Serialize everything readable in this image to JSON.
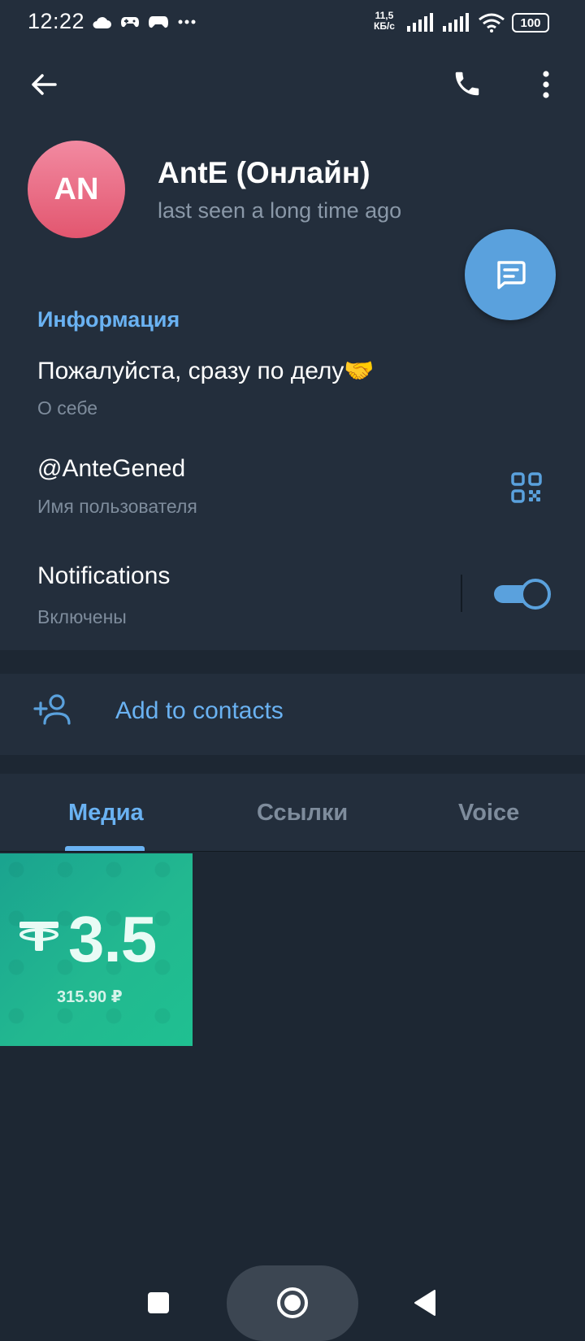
{
  "status_bar": {
    "time": "12:22",
    "net_speed_value": "11,5",
    "net_speed_unit": "КБ/с",
    "battery": "100",
    "icons": [
      "cloud-icon",
      "gamepad-icon",
      "gamepad-icon",
      "more-dots-icon",
      "signal-icon",
      "signal-icon",
      "wifi-icon",
      "battery-icon"
    ]
  },
  "toolbar": {
    "back_icon": "arrow-left-icon",
    "call_icon": "phone-icon",
    "menu_icon": "more-vertical-icon"
  },
  "profile": {
    "avatar_initials": "AN",
    "name": "AntE (Онлайн)",
    "status": "last seen a long time ago",
    "avatar_colors": [
      "#f28aa1",
      "#e2566f"
    ]
  },
  "fab": {
    "icon": "message-icon",
    "color": "#5aa1dd"
  },
  "info": {
    "section_title": "Информация",
    "bio_value": "Пожалуйста, сразу по делу🤝",
    "bio_label": "О себе",
    "username_value": "@AnteGened",
    "username_label": "Имя пользователя",
    "qr_icon": "qr-code-icon",
    "notifications_value": "Notifications",
    "notifications_label": "Включены",
    "notifications_enabled": true
  },
  "actions": {
    "add_contact_label": "Add to contacts",
    "add_contact_icon": "person-add-icon"
  },
  "tabs": {
    "items": [
      {
        "label": "Медиа",
        "active": true
      },
      {
        "label": "Ссылки",
        "active": false
      },
      {
        "label": "Voice",
        "active": false
      }
    ]
  },
  "media": {
    "items": [
      {
        "amount": "3.5",
        "subtitle": "315.90 ₽",
        "icon": "tether-icon"
      }
    ]
  },
  "nav": {
    "recents_icon": "square-icon",
    "home_icon": "circle-icon",
    "back_icon": "triangle-back-icon"
  },
  "colors": {
    "accent": "#6ab2f2",
    "background": "#1d2733",
    "panel": "#232e3c",
    "muted_text": "#7e8c9c"
  }
}
